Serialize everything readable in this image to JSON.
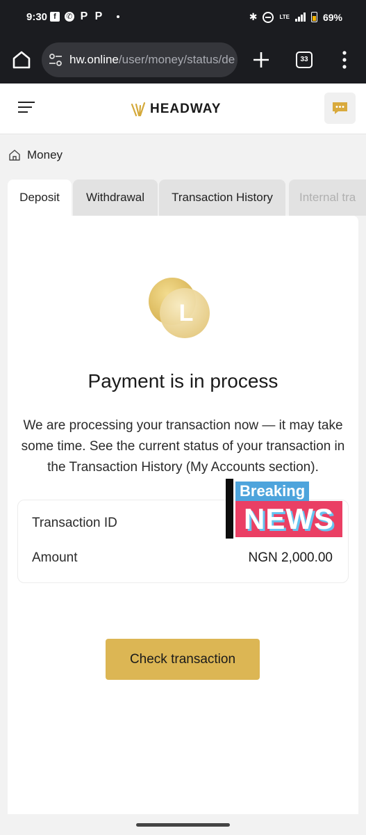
{
  "status_bar": {
    "time": "9:30",
    "notification_icons": [
      "facebook-icon",
      "whatsapp-icon",
      "paypal-icon",
      "paypal-icon"
    ],
    "system_icons": [
      "bluetooth-icon",
      "do-not-disturb-icon",
      "lte-icon",
      "signal-icon",
      "battery-icon"
    ],
    "lte_label": "LTE",
    "battery_percent": "69%"
  },
  "browser": {
    "url_domain": "hw.online",
    "url_path": "/user/money/status/de",
    "tab_count": "33"
  },
  "header": {
    "logo_text": "HEADWAY",
    "brand_color": "#d4a93b"
  },
  "breadcrumb": {
    "label": "Money"
  },
  "tabs": [
    {
      "label": "Deposit",
      "active": true
    },
    {
      "label": "Withdrawal",
      "active": false
    },
    {
      "label": "Transaction History",
      "active": false
    },
    {
      "label": "Internal tra",
      "active": false
    }
  ],
  "status": {
    "title": "Payment is in process",
    "message": "We are processing your transaction now — it may take some time. See the current status of your transaction in the Transaction History (My Accounts section).",
    "coin_letter": "L"
  },
  "details": {
    "transaction_id_label": "Transaction ID",
    "transaction_id_value": "",
    "amount_label": "Amount",
    "amount_value": "NGN 2,000.00"
  },
  "actions": {
    "check_label": "Check transaction",
    "button_color": "#dcb654"
  },
  "overlay": {
    "breaking": "Breaking",
    "news": "NEWS"
  }
}
